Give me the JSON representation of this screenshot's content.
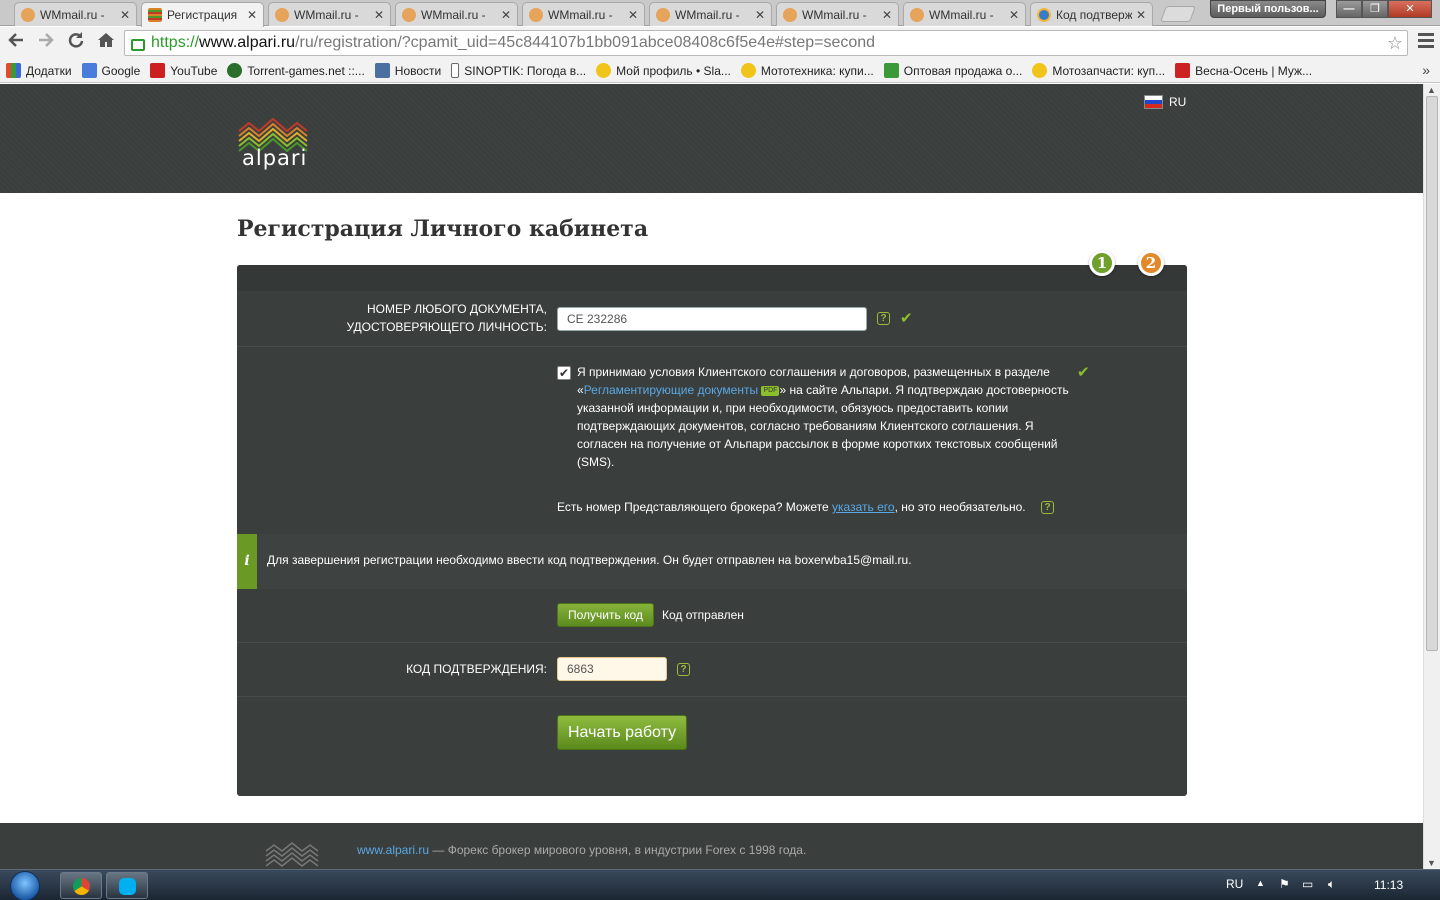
{
  "browser": {
    "tabs": [
      {
        "title": "WMmail.ru - ",
        "favicon": "wmmail-icon",
        "active": false
      },
      {
        "title": "Регистрация",
        "favicon": "alpari-icon",
        "active": true
      },
      {
        "title": "WMmail.ru - ",
        "favicon": "wmmail-icon",
        "active": false
      },
      {
        "title": "WMmail.ru - ",
        "favicon": "wmmail-icon",
        "active": false
      },
      {
        "title": "WMmail.ru - ",
        "favicon": "wmmail-icon",
        "active": false
      },
      {
        "title": "WMmail.ru - ",
        "favicon": "wmmail-icon",
        "active": false
      },
      {
        "title": "WMmail.ru - ",
        "favicon": "wmmail-icon",
        "active": false
      },
      {
        "title": "WMmail.ru - ",
        "favicon": "wmmail-icon",
        "active": false
      },
      {
        "title": "Код подтверж",
        "favicon": "globe-icon",
        "active": false
      }
    ],
    "tab_close_glyph": "✕",
    "profile_button": "Первый пользов...",
    "window_buttons": {
      "minimize": "—",
      "maximize": "❐",
      "close": "✕"
    },
    "url": {
      "scheme": "https://",
      "host": "www.alpari.ru",
      "path": "/ru/registration/?cpamit_uid=45c844107b1bb091abce08408c6f5e4e#step=second"
    },
    "bookmarks": [
      {
        "label": "Додатки",
        "icon": "apps-icon",
        "color": "#e04a2f"
      },
      {
        "label": "Google",
        "icon": "google-icon",
        "color": "#4a7ddb"
      },
      {
        "label": "YouTube",
        "icon": "youtube-icon",
        "color": "#cc1f1f"
      },
      {
        "label": "Torrent-games.net ::...",
        "icon": "torrent-icon",
        "color": "#2b6e2b"
      },
      {
        "label": "Новости",
        "icon": "vk-icon",
        "color": "#4a6fa0"
      },
      {
        "label": "SINOPTIK: Погода в...",
        "icon": "sinoptik-icon",
        "color": "#6a6a6a"
      },
      {
        "label": "Мой профиль • Sla...",
        "icon": "olx-icon",
        "color": "#f0c419"
      },
      {
        "label": "Мототехника: купи...",
        "icon": "olx-icon",
        "color": "#f0c419"
      },
      {
        "label": "Оптовая продажа о...",
        "icon": "cart-icon",
        "color": "#3a9a3a"
      },
      {
        "label": "Мотозапчасти: куп...",
        "icon": "olx-icon",
        "color": "#f0c419"
      },
      {
        "label": "Весна-Осень | Муж...",
        "icon": "shop-icon",
        "color": "#cc2222"
      }
    ],
    "bookmarks_more": "»"
  },
  "site": {
    "logo_text": "alpari",
    "language": "RU"
  },
  "page": {
    "title": "Регистрация Личного кабинета",
    "steps": [
      "1",
      "2"
    ],
    "document_label_line1": "НОМЕР ЛЮБОГО ДОКУМЕНТА,",
    "document_label_line2": "УДОСТОВЕРЯЮЩЕГО ЛИЧНОСТЬ:",
    "document_value": "CE 232286",
    "help_glyph": "?",
    "check_glyph": "✔",
    "checkbox_glyph": "✔",
    "terms_part1": "Я принимаю условия Клиентского соглашения и договоров, размещенных в разделе «",
    "terms_link": "Регламентирующие документы",
    "terms_pdf": "PDF",
    "terms_part2": "» на сайте Альпари. Я подтверждаю достоверность указанной информации и, при необходимости, обязуюсь предоставить копии подтверждающих документов, согласно требованиям Клиентского соглашения. Я согласен на получение от Альпари рассылок в форме коротких текстовых сообщений (SMS).",
    "broker_part1": "Есть номер Представляющего брокера? Можете ",
    "broker_link": "указать его",
    "broker_part2": ", но это необязательно.",
    "info_glyph": "i",
    "info_text": "Для завершения регистрации необходимо ввести код подтверждения. Он будет отправлен на boxerwba15@mail.ru.",
    "get_code_button": "Получить код",
    "code_sent_text": "Код отправлен",
    "code_label": "КОД ПОДТВЕРЖДЕНИЯ:",
    "code_value": "6863",
    "start_button": "Начать работу"
  },
  "footer": {
    "link": "www.alpari.ru",
    "text": " — Форекс брокер мирового уровня, в индустрии Forex с 1998 года."
  },
  "taskbar": {
    "language": "RU",
    "clock": "11:13"
  },
  "colors": {
    "accent_green": "#6fa02b",
    "step2_orange": "#e2892a",
    "panel_dark": "#3a3e3c",
    "link_blue": "#5aa9e6"
  }
}
